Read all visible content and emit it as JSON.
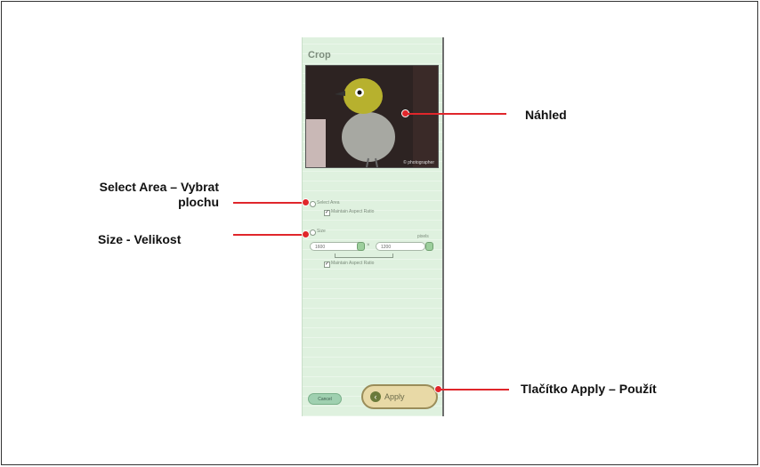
{
  "panel": {
    "title": "Crop",
    "preview_caption": "© photographer",
    "select_area_label": "Select Area",
    "maintain_aspect_1": "Maintain Aspect Ratio",
    "size_label": "Size",
    "unit_label": "pixels",
    "width_value": "1600",
    "height_value": "1200",
    "times": "×",
    "maintain_aspect_2": "Maintain Aspect Ratio",
    "cancel_label": "Cancel",
    "apply_label": "Apply",
    "apply_icon": "‹"
  },
  "callouts": {
    "preview": "Náhled",
    "select_area_line1": "Select Area – Vybrat",
    "select_area_line2": "plochu",
    "size": "Size - Velikost",
    "apply": "Tlačítko Apply – Použít"
  },
  "colors": {
    "callout_red": "#e0262b",
    "panel_bg": "#dff1df"
  }
}
